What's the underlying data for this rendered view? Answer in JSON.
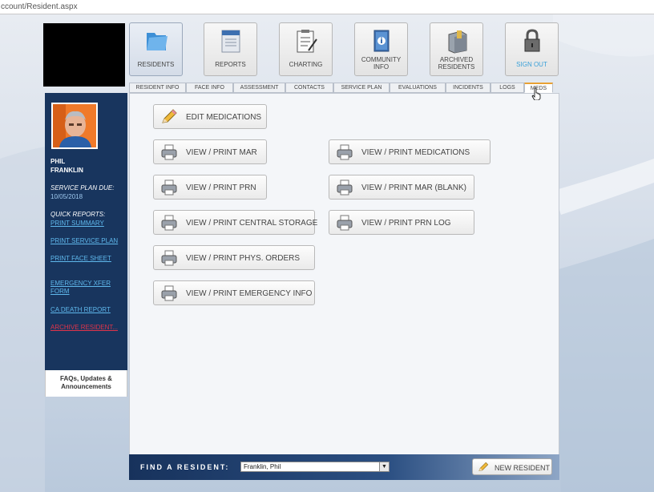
{
  "browser": {
    "url": "ccount/Resident.aspx"
  },
  "nav": {
    "residents": "RESIDENTS",
    "reports": "REPORTS",
    "charting": "CHARTING",
    "community_1": "COMMUNITY",
    "community_2": "INFO",
    "archived_1": "ARCHIVED",
    "archived_2": "RESIDENTS",
    "sign_out": "SIGN OUT"
  },
  "tabs": {
    "resident_info": "RESIDENT INFO",
    "face_info": "FACE INFO",
    "assessment": "ASSESSMENT",
    "contacts": "CONTACTS",
    "service_plan": "SERVICE PLAN",
    "evaluations": "EVALUATIONS",
    "incidents": "INCIDENTS",
    "logs": "LOGS",
    "meds": "MEDS"
  },
  "sidebar": {
    "first_name": "PHIL",
    "last_name": "FRANKLIN",
    "service_plan_due_label": "SERVICE PLAN DUE:",
    "service_plan_due_date": "10/05/2018",
    "quick_reports_label": "QUICK REPORTS:",
    "links": {
      "print_summary": "PRINT SUMMARY",
      "print_service_plan": "PRINT SERVICE PLAN",
      "print_face_sheet": "PRINT FACE SHEET",
      "emergency_xfer_form": "EMERGENCY XFER FORM",
      "ca_death_report": "CA DEATH REPORT",
      "archive_resident": "ARCHIVE RESIDENT..."
    },
    "faq_1": "FAQs, Updates &",
    "faq_2": "Announcements"
  },
  "meds": {
    "edit_medications": "EDIT MEDICATIONS",
    "view_print_mar": "VIEW / PRINT MAR",
    "view_print_prn": "VIEW / PRINT PRN",
    "view_print_central_storage": "VIEW / PRINT CENTRAL STORAGE",
    "view_print_phys_orders": "VIEW / PRINT PHYS. ORDERS",
    "view_print_emergency_info": "VIEW / PRINT EMERGENCY INFO",
    "view_print_medications": "VIEW / PRINT MEDICATIONS",
    "view_print_mar_blank": "VIEW / PRINT MAR (BLANK)",
    "view_print_prn_log": "VIEW / PRINT PRN LOG"
  },
  "footer": {
    "find_label": "FIND A RESIDENT:",
    "selected_resident": "Franklin, Phil",
    "new_resident": "NEW RESIDENT"
  },
  "icons": {
    "residents": "folder-icon",
    "reports": "report-icon",
    "charting": "clipboard-icon",
    "community": "info-book-icon",
    "archived": "archive-cabinet-icon",
    "sign_out": "padlock-icon",
    "edit": "pencil-icon",
    "print": "printer-icon"
  }
}
